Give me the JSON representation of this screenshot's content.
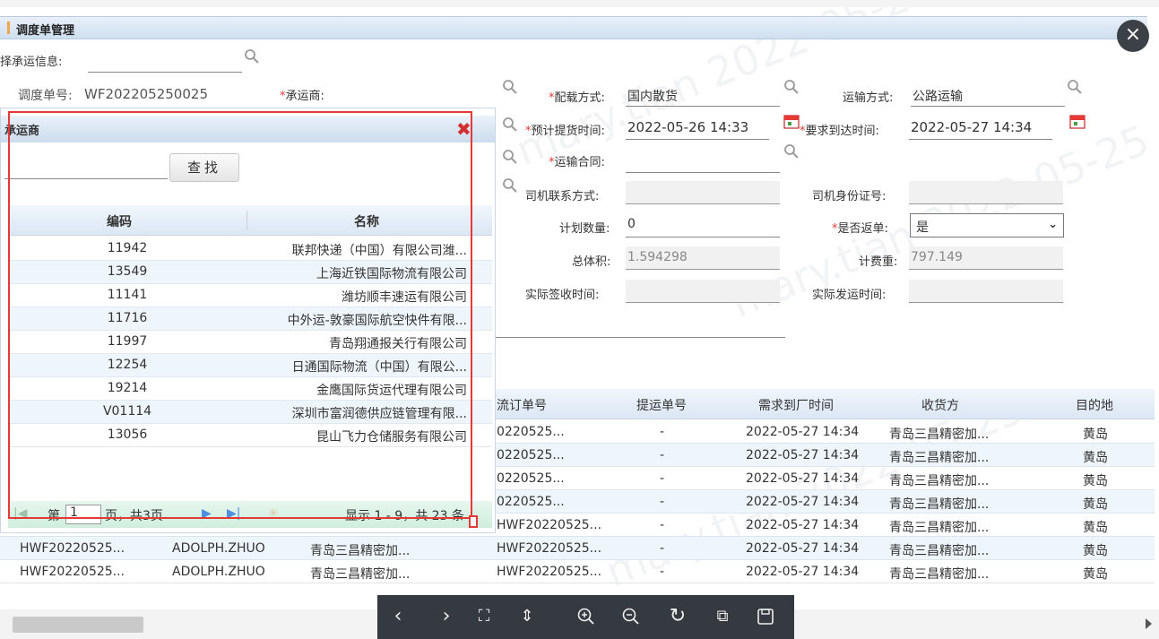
{
  "window": {
    "title": "调度单管理",
    "close_glyph": "×"
  },
  "form": {
    "select_carrier_label": "择承运信息:",
    "dispatch_no_label": "调度单号:",
    "dispatch_no_value": "WF202205250025",
    "carrier_label": "承运商:",
    "load_mode_label": "配载方式:",
    "load_mode_value": "国内散货",
    "transport_mode_label": "运输方式:",
    "transport_mode_value": "公路运输",
    "pickup_time_label": "预计提货时间:",
    "pickup_time_value": "2022-05-26 14:33",
    "arrival_time_label": "要求到达时间:",
    "arrival_time_value": "2022-05-27 14:34",
    "contract_label": "运输合同:",
    "driver_contact_label": "司机联系方式:",
    "driver_id_label": "司机身份证号:",
    "plan_qty_label": "计划数量:",
    "plan_qty_value": "0",
    "return_label": "是否返单:",
    "return_value": "是",
    "volume_label": "总体积:",
    "volume_value": "1.594298",
    "fee_weight_label": "计费重:",
    "fee_weight_value": "797.149",
    "sign_time_label": "实际签收时间:",
    "ship_time_label": "实际发运时间:"
  },
  "main_table": {
    "headers": [
      "流订单号",
      "提运单号",
      "需求到厂时间",
      "收货方",
      "目的地"
    ],
    "rows": [
      {
        "c0": "",
        "c1": "",
        "c2": "",
        "c3": "0220525...",
        "c4": "-",
        "c5": "2022-05-27 14:34",
        "c6": "青岛三昌精密加...",
        "c7": "黄岛"
      },
      {
        "c0": "",
        "c1": "",
        "c2": "",
        "c3": "0220525...",
        "c4": "-",
        "c5": "2022-05-27 14:34",
        "c6": "青岛三昌精密加...",
        "c7": "黄岛"
      },
      {
        "c0": "",
        "c1": "",
        "c2": "",
        "c3": "0220525...",
        "c4": "-",
        "c5": "2022-05-27 14:34",
        "c6": "青岛三昌精密加...",
        "c7": "黄岛"
      },
      {
        "c0": "",
        "c1": "",
        "c2": "",
        "c3": "0220525...",
        "c4": "-",
        "c5": "2022-05-27 14:34",
        "c6": "青岛三昌精密加...",
        "c7": "黄岛"
      },
      {
        "c0": "HWF20220525...",
        "c1": "ADOLPH.ZHUO",
        "c2": "青岛三昌精密加...",
        "c3": "HWF20220525...",
        "c4": "-",
        "c5": "2022-05-27 14:34",
        "c6": "青岛三昌精密加...",
        "c7": "黄岛"
      },
      {
        "c0": "HWF20220525...",
        "c1": "ADOLPH.ZHUO",
        "c2": "青岛三昌精密加...",
        "c3": "HWF20220525...",
        "c4": "-",
        "c5": "2022-05-27 14:34",
        "c6": "青岛三昌精密加...",
        "c7": "黄岛"
      },
      {
        "c0": "HWF20220525...",
        "c1": "ADOLPH.ZHUO",
        "c2": "青岛三昌精密加...",
        "c3": "HWF20220525...",
        "c4": "-",
        "c5": "2022-05-27 14:34",
        "c6": "青岛三昌精密加...",
        "c7": "黄岛"
      }
    ]
  },
  "popup": {
    "title": "承运商",
    "close_glyph": "✖",
    "search_button": "查找",
    "headers": [
      "编码",
      "名称"
    ],
    "rows": [
      {
        "code": "11942",
        "name": "联邦快递（中国）有限公司潍..."
      },
      {
        "code": "13549",
        "name": "上海近铁国际物流有限公司"
      },
      {
        "code": "11141",
        "name": "潍坊顺丰速运有限公司"
      },
      {
        "code": "11716",
        "name": "中外运-敦豪国际航空快件有限..."
      },
      {
        "code": "11997",
        "name": "青岛翔通报关行有限公司"
      },
      {
        "code": "12254",
        "name": "日通国际物流（中国）有限公..."
      },
      {
        "code": "19214",
        "name": "金鹰国际货运代理有限公司"
      },
      {
        "code": "V01114",
        "name": "深圳市富润德供应链管理有限..."
      },
      {
        "code": "13056",
        "name": "昆山飞力仓储服务有限公司"
      }
    ],
    "pager": {
      "page_prefix": "第",
      "page_value": "1",
      "page_suffix": "页，共3页",
      "summary": "显示 1 - 9，共 23 条"
    }
  },
  "watermark": "mary.tian 2022-05-25",
  "colors": {
    "accent": "#f0a44b",
    "required": "#e53935",
    "header_bg": "#dbe7f4",
    "pager_bg": "#cfeedd",
    "viewer_bg": "#353a40"
  }
}
